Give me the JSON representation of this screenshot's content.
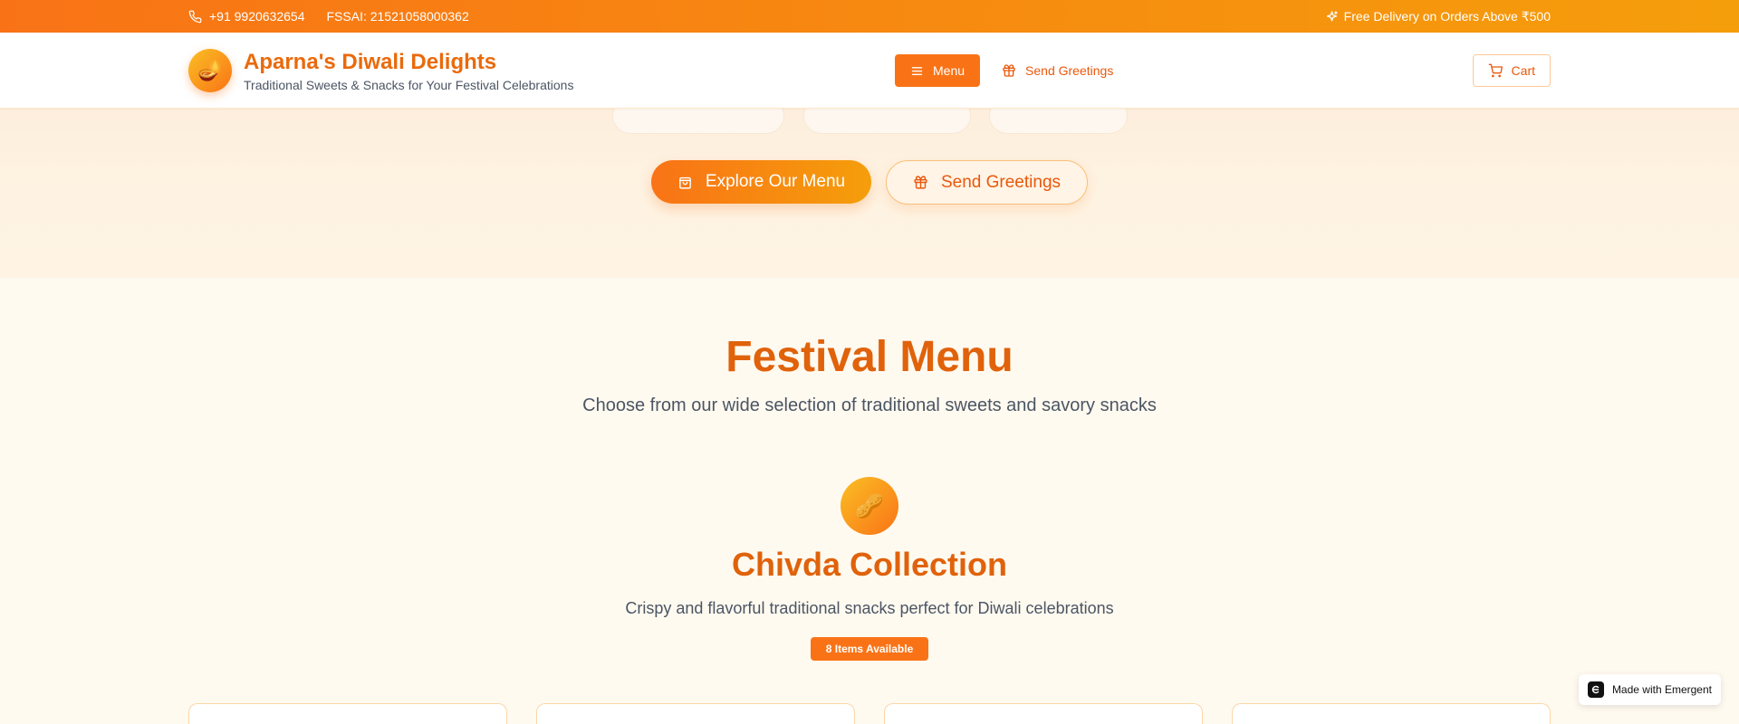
{
  "topbar": {
    "phone": "+91 9920632654",
    "fssai": "FSSAI: 21521058000362",
    "delivery": "Free Delivery on Orders Above ₹500"
  },
  "header": {
    "title": "Aparna's Diwali Delights",
    "subtitle": "Traditional Sweets & Snacks for Your Festival Celebrations",
    "logo_glyph": "🪔",
    "menu_label": "Menu",
    "greetings_label": "Send Greetings",
    "cart_label": "Cart"
  },
  "hero": {
    "explore_label": "Explore Our Menu",
    "greetings_label": "Send Greetings"
  },
  "festival_menu": {
    "title": "Festival Menu",
    "subtitle": "Choose from our wide selection of traditional sweets and savory snacks",
    "category": {
      "icon_glyph": "🥜",
      "title": "Chivda Collection",
      "subtitle": "Crispy and flavorful traditional snacks perfect for Diwali celebrations",
      "badge": "8 Items Available"
    }
  },
  "footer_badge": {
    "label": "Made with Emergent"
  },
  "colors": {
    "accent": "#f97316",
    "accent_dark": "#ea580c",
    "accent_gold": "#f59e0b"
  }
}
